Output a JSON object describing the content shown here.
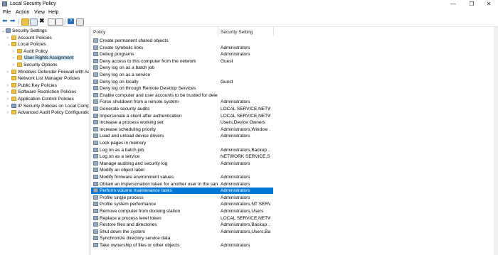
{
  "window": {
    "title": "Local Security Policy",
    "min": "—",
    "max": "❐",
    "close": "✕"
  },
  "menu": [
    "File",
    "Action",
    "View",
    "Help"
  ],
  "tree": [
    {
      "label": "Security Settings",
      "level": 0,
      "exp": "⌄",
      "icon": "sec-ico"
    },
    {
      "label": "Account Policies",
      "level": 1,
      "exp": "›",
      "icon": "folder"
    },
    {
      "label": "Local Policies",
      "level": 1,
      "exp": "⌄",
      "icon": "folder"
    },
    {
      "label": "Audit Policy",
      "level": 2,
      "exp": "›",
      "icon": "folder"
    },
    {
      "label": "User Rights Assignment",
      "level": 2,
      "exp": "›",
      "icon": "folder",
      "selected": true
    },
    {
      "label": "Security Options",
      "level": 2,
      "exp": "›",
      "icon": "folder"
    },
    {
      "label": "Windows Defender Firewall with Adva",
      "level": 1,
      "exp": "›",
      "icon": "folder"
    },
    {
      "label": "Network List Manager Policies",
      "level": 1,
      "exp": "",
      "icon": "folder"
    },
    {
      "label": "Public Key Policies",
      "level": 1,
      "exp": "›",
      "icon": "folder"
    },
    {
      "label": "Software Restriction Policies",
      "level": 1,
      "exp": "›",
      "icon": "folder"
    },
    {
      "label": "Application Control Policies",
      "level": 1,
      "exp": "›",
      "icon": "folder"
    },
    {
      "label": "IP Security Policies on Local Compute",
      "level": 1,
      "exp": "›",
      "icon": "sec-ico"
    },
    {
      "label": "Advanced Audit Policy Configuration",
      "level": 1,
      "exp": "›",
      "icon": "folder"
    }
  ],
  "columns": {
    "policy": "Policy",
    "setting": "Security Setting"
  },
  "rows": [
    [
      "Create permanent shared objects",
      ""
    ],
    [
      "Create symbolic links",
      "Administrators"
    ],
    [
      "Debug programs",
      "Administrators"
    ],
    [
      "Deny access to this computer from the network",
      "Guest"
    ],
    [
      "Deny log on as a batch job",
      ""
    ],
    [
      "Deny log on as a service",
      ""
    ],
    [
      "Deny log on locally",
      "Guest"
    ],
    [
      "Deny log on through Remote Desktop Services",
      ""
    ],
    [
      "Enable computer and user accounts to be trusted for delega...",
      ""
    ],
    [
      "Force shutdown from a remote system",
      "Administrators"
    ],
    [
      "Generate security audits",
      "LOCAL SERVICE,NETWO..."
    ],
    [
      "Impersonate a client after authentication",
      "LOCAL SERVICE,NETWO..."
    ],
    [
      "Increase a process working set",
      "Users,Device Owners"
    ],
    [
      "Increase scheduling priority",
      "Administrators,Window ..."
    ],
    [
      "Load and unload device drivers",
      "Administrators"
    ],
    [
      "Lock pages in memory",
      ""
    ],
    [
      "Log on as a batch job",
      "Administrators,Backup ..."
    ],
    [
      "Log on as a service",
      "NETWORK SERVICE,SQL..."
    ],
    [
      "Manage auditing and security log",
      "Administrators"
    ],
    [
      "Modify an object label",
      ""
    ],
    [
      "Modify firmware environment values",
      "Administrators"
    ],
    [
      "Obtain an impersonation token for another user in the same...",
      "Administrators"
    ],
    [
      "Perform volume maintenance tasks",
      "Administrators"
    ],
    [
      "Profile single process",
      "Administrators"
    ],
    [
      "Profile system performance",
      "Administrators,NT SERVI..."
    ],
    [
      "Remove computer from docking station",
      "Administrators,Users"
    ],
    [
      "Replace a process level token",
      "LOCAL SERVICE,NETWO..."
    ],
    [
      "Restore files and directories",
      "Administrators,Backup ..."
    ],
    [
      "Shut down the system",
      "Administrators,Users,Ba..."
    ],
    [
      "Synchronize directory service data",
      ""
    ],
    [
      "Take ownership of files or other objects",
      "Administrators"
    ]
  ],
  "selected_row": 22
}
